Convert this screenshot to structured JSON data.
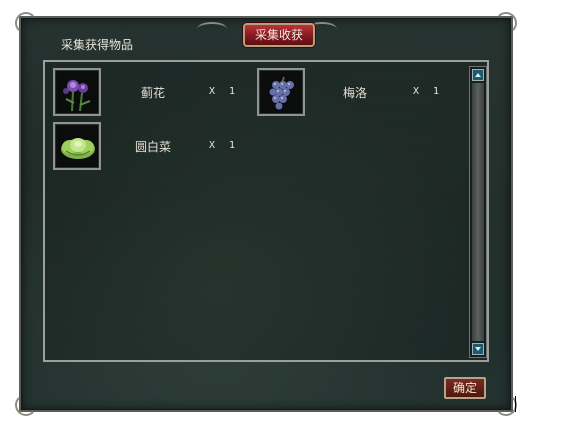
{
  "dialog": {
    "title": "采集获得物品",
    "badge": "采集收获",
    "confirm_label": "确定"
  },
  "items": [
    {
      "name": "蓟花",
      "x": "X",
      "qty": "1",
      "icon": "thistle-flower-icon"
    },
    {
      "name": "梅洛",
      "x": "X",
      "qty": "1",
      "icon": "grape-cluster-icon"
    },
    {
      "name": "圆白菜",
      "x": "X",
      "qty": "1",
      "icon": "cabbage-icon"
    }
  ],
  "colors": {
    "panel_bg": "#263330",
    "badge_red": "#8a1a22",
    "text": "#e6e2d6",
    "scroll_button": "#1d5a6e"
  }
}
